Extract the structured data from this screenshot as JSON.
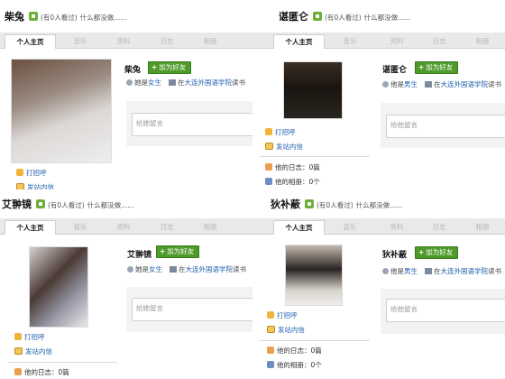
{
  "common": {
    "viewed": "(有0人看过)",
    "status": "什么都没做......",
    "tabs": [
      "个人主页",
      "音乐",
      "资料",
      "日志",
      "相册"
    ],
    "add_friend": "加为好友",
    "he_is_prefix": "他是",
    "she_is_prefix": "她是",
    "at_school_prefix": "在",
    "school": "大连外国语学院",
    "study_suffix": "读书",
    "message_placeholder": "给他留言",
    "message_placeholder_her": "给她留言",
    "say_hi": "打招呼",
    "send_mail": "发站内信",
    "blog_label": "他的日志：0篇",
    "album_label": "他的相册：0个",
    "accent_green": "#4e9a2a",
    "link_blue": "#1f5fae"
  },
  "profiles": [
    {
      "name": "柴兔",
      "gender": "女生",
      "icon": "user-icon"
    },
    {
      "name": "谌匿仑",
      "gender": "男生",
      "icon": "user-icon"
    },
    {
      "name": "艾翀镜",
      "gender": "女生",
      "icon": "user-icon"
    },
    {
      "name": "狄补蔽",
      "gender": "男生",
      "icon": "user-icon"
    }
  ]
}
